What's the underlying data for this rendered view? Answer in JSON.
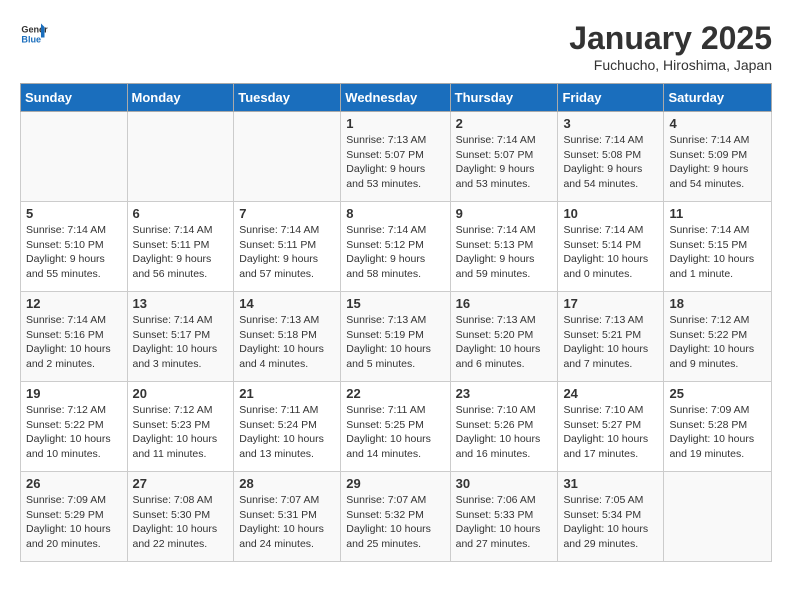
{
  "header": {
    "logo_line1": "General",
    "logo_line2": "Blue",
    "month": "January 2025",
    "location": "Fuchucho, Hiroshima, Japan"
  },
  "weekdays": [
    "Sunday",
    "Monday",
    "Tuesday",
    "Wednesday",
    "Thursday",
    "Friday",
    "Saturday"
  ],
  "weeks": [
    [
      {
        "num": "",
        "info": ""
      },
      {
        "num": "",
        "info": ""
      },
      {
        "num": "",
        "info": ""
      },
      {
        "num": "1",
        "info": "Sunrise: 7:13 AM\nSunset: 5:07 PM\nDaylight: 9 hours and 53 minutes."
      },
      {
        "num": "2",
        "info": "Sunrise: 7:14 AM\nSunset: 5:07 PM\nDaylight: 9 hours and 53 minutes."
      },
      {
        "num": "3",
        "info": "Sunrise: 7:14 AM\nSunset: 5:08 PM\nDaylight: 9 hours and 54 minutes."
      },
      {
        "num": "4",
        "info": "Sunrise: 7:14 AM\nSunset: 5:09 PM\nDaylight: 9 hours and 54 minutes."
      }
    ],
    [
      {
        "num": "5",
        "info": "Sunrise: 7:14 AM\nSunset: 5:10 PM\nDaylight: 9 hours and 55 minutes."
      },
      {
        "num": "6",
        "info": "Sunrise: 7:14 AM\nSunset: 5:11 PM\nDaylight: 9 hours and 56 minutes."
      },
      {
        "num": "7",
        "info": "Sunrise: 7:14 AM\nSunset: 5:11 PM\nDaylight: 9 hours and 57 minutes."
      },
      {
        "num": "8",
        "info": "Sunrise: 7:14 AM\nSunset: 5:12 PM\nDaylight: 9 hours and 58 minutes."
      },
      {
        "num": "9",
        "info": "Sunrise: 7:14 AM\nSunset: 5:13 PM\nDaylight: 9 hours and 59 minutes."
      },
      {
        "num": "10",
        "info": "Sunrise: 7:14 AM\nSunset: 5:14 PM\nDaylight: 10 hours and 0 minutes."
      },
      {
        "num": "11",
        "info": "Sunrise: 7:14 AM\nSunset: 5:15 PM\nDaylight: 10 hours and 1 minute."
      }
    ],
    [
      {
        "num": "12",
        "info": "Sunrise: 7:14 AM\nSunset: 5:16 PM\nDaylight: 10 hours and 2 minutes."
      },
      {
        "num": "13",
        "info": "Sunrise: 7:14 AM\nSunset: 5:17 PM\nDaylight: 10 hours and 3 minutes."
      },
      {
        "num": "14",
        "info": "Sunrise: 7:13 AM\nSunset: 5:18 PM\nDaylight: 10 hours and 4 minutes."
      },
      {
        "num": "15",
        "info": "Sunrise: 7:13 AM\nSunset: 5:19 PM\nDaylight: 10 hours and 5 minutes."
      },
      {
        "num": "16",
        "info": "Sunrise: 7:13 AM\nSunset: 5:20 PM\nDaylight: 10 hours and 6 minutes."
      },
      {
        "num": "17",
        "info": "Sunrise: 7:13 AM\nSunset: 5:21 PM\nDaylight: 10 hours and 7 minutes."
      },
      {
        "num": "18",
        "info": "Sunrise: 7:12 AM\nSunset: 5:22 PM\nDaylight: 10 hours and 9 minutes."
      }
    ],
    [
      {
        "num": "19",
        "info": "Sunrise: 7:12 AM\nSunset: 5:22 PM\nDaylight: 10 hours and 10 minutes."
      },
      {
        "num": "20",
        "info": "Sunrise: 7:12 AM\nSunset: 5:23 PM\nDaylight: 10 hours and 11 minutes."
      },
      {
        "num": "21",
        "info": "Sunrise: 7:11 AM\nSunset: 5:24 PM\nDaylight: 10 hours and 13 minutes."
      },
      {
        "num": "22",
        "info": "Sunrise: 7:11 AM\nSunset: 5:25 PM\nDaylight: 10 hours and 14 minutes."
      },
      {
        "num": "23",
        "info": "Sunrise: 7:10 AM\nSunset: 5:26 PM\nDaylight: 10 hours and 16 minutes."
      },
      {
        "num": "24",
        "info": "Sunrise: 7:10 AM\nSunset: 5:27 PM\nDaylight: 10 hours and 17 minutes."
      },
      {
        "num": "25",
        "info": "Sunrise: 7:09 AM\nSunset: 5:28 PM\nDaylight: 10 hours and 19 minutes."
      }
    ],
    [
      {
        "num": "26",
        "info": "Sunrise: 7:09 AM\nSunset: 5:29 PM\nDaylight: 10 hours and 20 minutes."
      },
      {
        "num": "27",
        "info": "Sunrise: 7:08 AM\nSunset: 5:30 PM\nDaylight: 10 hours and 22 minutes."
      },
      {
        "num": "28",
        "info": "Sunrise: 7:07 AM\nSunset: 5:31 PM\nDaylight: 10 hours and 24 minutes."
      },
      {
        "num": "29",
        "info": "Sunrise: 7:07 AM\nSunset: 5:32 PM\nDaylight: 10 hours and 25 minutes."
      },
      {
        "num": "30",
        "info": "Sunrise: 7:06 AM\nSunset: 5:33 PM\nDaylight: 10 hours and 27 minutes."
      },
      {
        "num": "31",
        "info": "Sunrise: 7:05 AM\nSunset: 5:34 PM\nDaylight: 10 hours and 29 minutes."
      },
      {
        "num": "",
        "info": ""
      }
    ]
  ]
}
